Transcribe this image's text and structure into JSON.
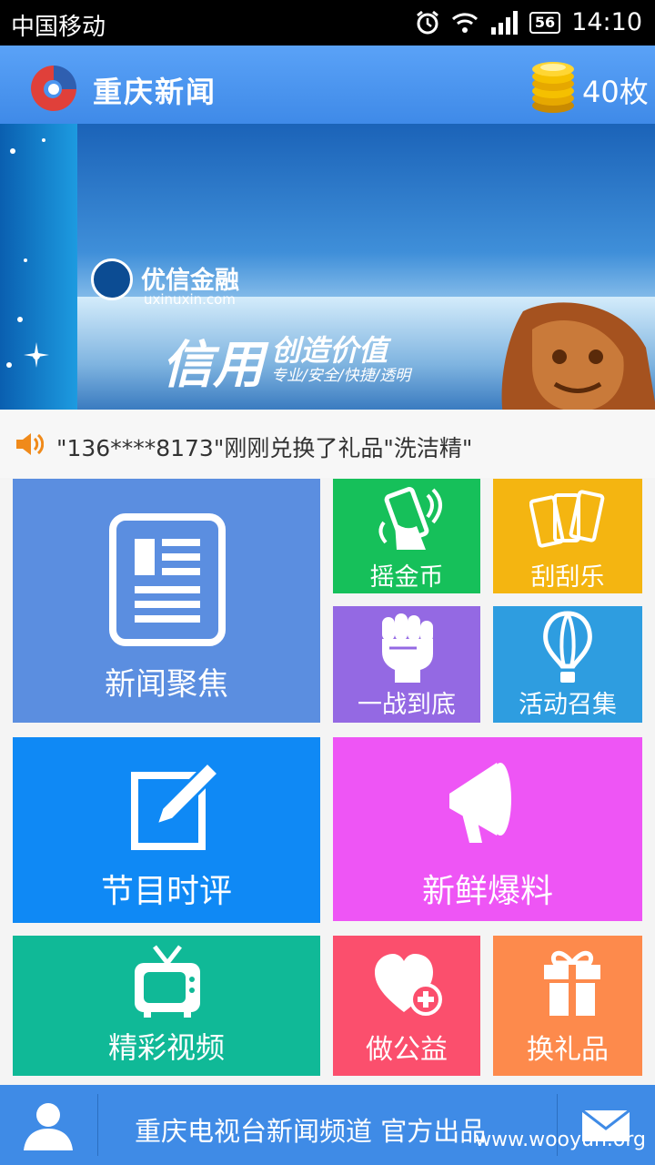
{
  "status": {
    "carrier": "中国移动",
    "battery": "56",
    "time": "14:10"
  },
  "appbar": {
    "title": "重庆新闻",
    "coins": "40枚"
  },
  "banner": {
    "brand": "优信金融",
    "url": "uxinuxin.com",
    "slogan_big": "信用",
    "slogan_small": "创造价值",
    "slogan_sub": "专业/安全/快捷/透明"
  },
  "ticker": {
    "text": "\"136****8173\"刚刚兑换了礼品\"洗洁精\""
  },
  "tiles": {
    "news_focus": "新闻聚焦",
    "shake_coins": "摇金币",
    "scratch": "刮刮乐",
    "fight": "一战到底",
    "events": "活动召集",
    "program_review": "节目时评",
    "fresh_report": "新鲜爆料",
    "videos": "精彩视频",
    "charity": "做公益",
    "gifts": "换礼品"
  },
  "footer": {
    "text": "重庆电视台新闻频道 官方出品"
  },
  "watermark": "www.wooyun.org",
  "colors": {
    "appbar": "#4a95ef",
    "news_focus": "#5b8ee0",
    "shake": "#16c05a",
    "scratch": "#f4b511",
    "fight": "#9469e3",
    "events": "#2e9de0",
    "program": "#0f89f5",
    "fresh": "#ee55f5",
    "videos": "#10b997",
    "charity": "#fb4f6d",
    "gifts": "#fd8a4c"
  }
}
